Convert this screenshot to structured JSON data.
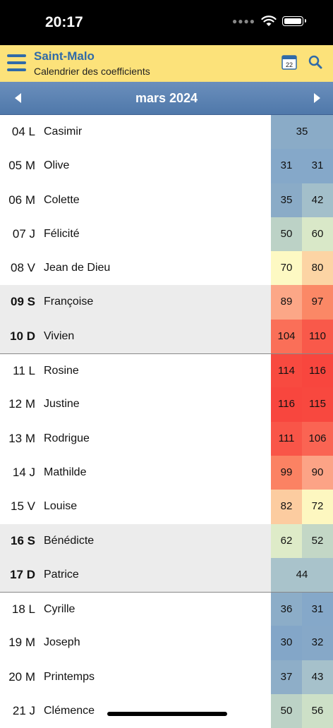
{
  "status": {
    "time": "20:17"
  },
  "header": {
    "title": "Saint-Malo",
    "subtitle": "Calendrier des coefficients",
    "calendar_day": "22"
  },
  "nav": {
    "month": "mars 2024"
  },
  "colors": {
    "header_bg": "#fce27a",
    "accent": "#2f6aa8",
    "nav_bg": "#5b82b4"
  },
  "rows": [
    {
      "day": "04 L",
      "saint": "Casimir",
      "coefs": [
        "35"
      ],
      "colors": [
        "#8aabc7"
      ],
      "weekend": false,
      "week_start": false
    },
    {
      "day": "05 M",
      "saint": "Olive",
      "coefs": [
        "31",
        "31"
      ],
      "colors": [
        "#85a8c9",
        "#85a8c9"
      ],
      "weekend": false,
      "week_start": false
    },
    {
      "day": "06 M",
      "saint": "Colette",
      "coefs": [
        "35",
        "42"
      ],
      "colors": [
        "#8aabc7",
        "#a3bfca"
      ],
      "weekend": false,
      "week_start": false
    },
    {
      "day": "07 J",
      "saint": "Félicité",
      "coefs": [
        "50",
        "60"
      ],
      "colors": [
        "#bcd2c6",
        "#d9e8c8"
      ],
      "weekend": false,
      "week_start": false
    },
    {
      "day": "08 V",
      "saint": "Jean de Dieu",
      "coefs": [
        "70",
        "80"
      ],
      "colors": [
        "#fdf9c3",
        "#fcd4a4"
      ],
      "weekend": false,
      "week_start": false
    },
    {
      "day": "09 S",
      "saint": "Françoise",
      "coefs": [
        "89",
        "97"
      ],
      "colors": [
        "#fca787",
        "#fb8866"
      ],
      "weekend": true,
      "week_start": false
    },
    {
      "day": "10 D",
      "saint": "Vivien",
      "coefs": [
        "104",
        "110"
      ],
      "colors": [
        "#fa6f58",
        "#f9594a"
      ],
      "weekend": true,
      "week_start": false
    },
    {
      "day": "11 L",
      "saint": "Rosine",
      "coefs": [
        "114",
        "116"
      ],
      "colors": [
        "#f84a40",
        "#f8463e"
      ],
      "weekend": false,
      "week_start": true
    },
    {
      "day": "12 M",
      "saint": "Justine",
      "coefs": [
        "116",
        "115"
      ],
      "colors": [
        "#f8463e",
        "#f8483f"
      ],
      "weekend": false,
      "week_start": false
    },
    {
      "day": "13 M",
      "saint": "Rodrigue",
      "coefs": [
        "111",
        "106"
      ],
      "colors": [
        "#f95548",
        "#fa6453"
      ],
      "weekend": false,
      "week_start": false
    },
    {
      "day": "14 J",
      "saint": "Mathilde",
      "coefs": [
        "99",
        "90"
      ],
      "colors": [
        "#fb8263",
        "#fca386"
      ],
      "weekend": false,
      "week_start": false
    },
    {
      "day": "15 V",
      "saint": "Louise",
      "coefs": [
        "82",
        "72"
      ],
      "colors": [
        "#fccca0",
        "#fdf7c0"
      ],
      "weekend": false,
      "week_start": false
    },
    {
      "day": "16 S",
      "saint": "Bénédicte",
      "coefs": [
        "62",
        "52"
      ],
      "colors": [
        "#deebc8",
        "#c3d7c6"
      ],
      "weekend": true,
      "week_start": false
    },
    {
      "day": "17 D",
      "saint": "Patrice",
      "coefs": [
        "44"
      ],
      "colors": [
        "#a9c3cb"
      ],
      "weekend": true,
      "week_start": false
    },
    {
      "day": "18 L",
      "saint": "Cyrille",
      "coefs": [
        "36",
        "31"
      ],
      "colors": [
        "#8cadc8",
        "#85a8c9"
      ],
      "weekend": false,
      "week_start": true
    },
    {
      "day": "19 M",
      "saint": "Joseph",
      "coefs": [
        "30",
        "32"
      ],
      "colors": [
        "#83a6c8",
        "#86a8c8"
      ],
      "weekend": false,
      "week_start": false
    },
    {
      "day": "20 M",
      "saint": "Printemps",
      "coefs": [
        "37",
        "43"
      ],
      "colors": [
        "#8eaec8",
        "#a6c1cb"
      ],
      "weekend": false,
      "week_start": false
    },
    {
      "day": "21 J",
      "saint": "Clémence",
      "coefs": [
        "50",
        "56"
      ],
      "colors": [
        "#bcd2c6",
        "#cde0c7"
      ],
      "weekend": false,
      "week_start": false
    }
  ]
}
